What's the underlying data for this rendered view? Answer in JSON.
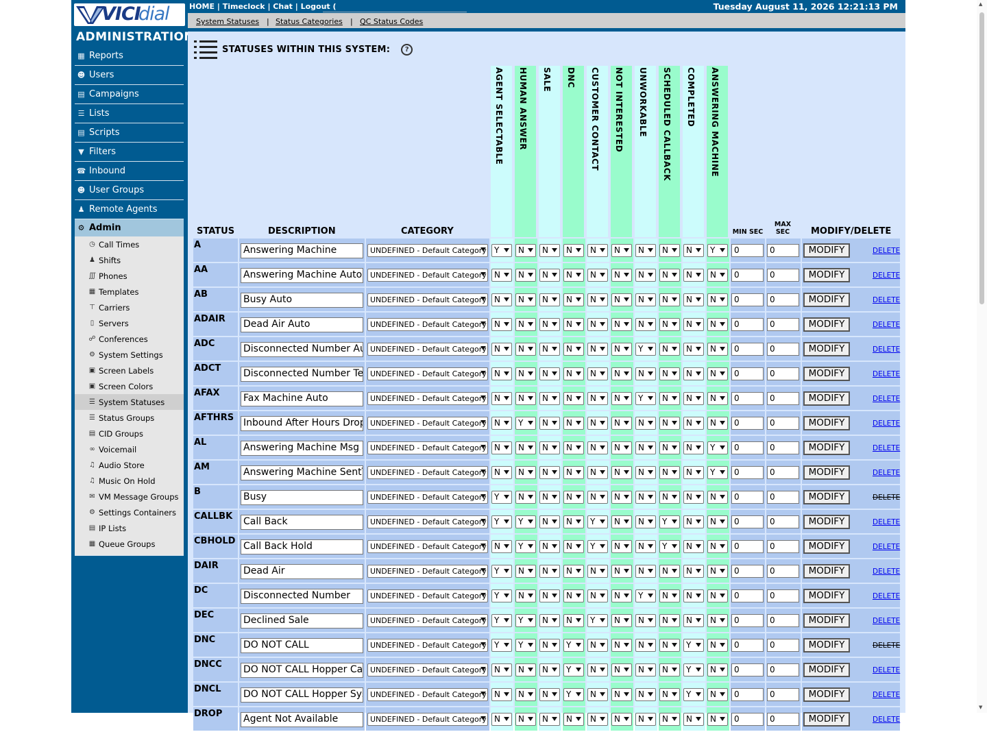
{
  "topbar": {
    "home": "HOME",
    "timeclock": "Timeclock",
    "chat": "Chat",
    "logout": "Logout (",
    "datetime": "Tuesday August 11, 2026 12:21:13 PM"
  },
  "subnav_links": {
    "system_statuses": "System Statuses ",
    "status_categories": "Status Categories ",
    "qc_status_codes": "QC Status Codes"
  },
  "logo": {
    "part1": "VICI",
    "part2": "dial"
  },
  "sidebar": {
    "title": "ADMINISTRATION",
    "items": [
      {
        "label": "Reports",
        "icon": "reports-icon"
      },
      {
        "label": "Users",
        "icon": "users-icon"
      },
      {
        "label": "Campaigns",
        "icon": "campaigns-icon"
      },
      {
        "label": "Lists",
        "icon": "lists-icon"
      },
      {
        "label": "Scripts",
        "icon": "scripts-icon"
      },
      {
        "label": "Filters",
        "icon": "filter-icon"
      },
      {
        "label": "Inbound",
        "icon": "inbound-icon"
      },
      {
        "label": "User Groups",
        "icon": "user-groups-icon"
      },
      {
        "label": "Remote Agents",
        "icon": "remote-agents-icon"
      }
    ],
    "active": {
      "label": "Admin",
      "icon": "gear-icon"
    },
    "subitems": [
      {
        "label": "Call Times",
        "icon": "clock-icon"
      },
      {
        "label": "Shifts",
        "icon": "shifts-icon"
      },
      {
        "label": "Phones",
        "icon": "phones-icon"
      },
      {
        "label": "Templates",
        "icon": "templates-icon"
      },
      {
        "label": "Carriers",
        "icon": "carriers-icon"
      },
      {
        "label": "Servers",
        "icon": "servers-icon"
      },
      {
        "label": "Conferences",
        "icon": "conferences-icon"
      },
      {
        "label": "System Settings",
        "icon": "system-settings-icon"
      },
      {
        "label": "Screen Labels",
        "icon": "screen-labels-icon"
      },
      {
        "label": "Screen Colors",
        "icon": "screen-colors-icon"
      },
      {
        "label": "System Statuses",
        "icon": "system-statuses-icon"
      },
      {
        "label": "Status Groups",
        "icon": "status-groups-icon"
      },
      {
        "label": "CID Groups",
        "icon": "cid-groups-icon"
      },
      {
        "label": "Voicemail",
        "icon": "voicemail-icon"
      },
      {
        "label": "Audio Store",
        "icon": "audio-store-icon"
      },
      {
        "label": "Music On Hold",
        "icon": "music-on-hold-icon"
      },
      {
        "label": "VM Message Groups",
        "icon": "vm-message-groups-icon"
      },
      {
        "label": "Settings Containers",
        "icon": "settings-containers-icon"
      },
      {
        "label": "IP Lists",
        "icon": "ip-lists-icon"
      },
      {
        "label": "Queue Groups",
        "icon": "queue-groups-icon"
      }
    ]
  },
  "page": {
    "title": "STATUSES WITHIN THIS SYSTEM:",
    "help_glyph": "?"
  },
  "columns": {
    "status": "STATUS",
    "description": "DESCRIPTION",
    "category": "CATEGORY",
    "flags": [
      "AGENT SELECTABLE",
      "HUMAN ANSWER",
      "SALE",
      "DNC",
      "CUSTOMER CONTACT",
      "NOT INTERESTED",
      "UNWORKABLE",
      "SCHEDULED CALLBACK",
      "COMPLETED",
      "ANSWERING MACHINE"
    ],
    "min_sec": "MIN SEC",
    "max_sec": "MAX SEC",
    "modify_delete": "MODIFY/DELETE"
  },
  "colors": {
    "flag_cyan": "#ccfcfc",
    "flag_green": "#99fccc",
    "row_bg": "#b0c9f0",
    "page_bg": "#d7e6fc",
    "brand_blue": "#015b91"
  },
  "button_label": "MODIFY",
  "delete_label": "DELETE",
  "category_default": "UNDEFINED - Default Category",
  "rows": [
    {
      "status": "A",
      "desc": "Answering Machine",
      "flags": [
        "Y",
        "N",
        "N",
        "N",
        "N",
        "N",
        "N",
        "N",
        "N",
        "Y"
      ],
      "min": "0",
      "max": "0",
      "delete_disabled": false
    },
    {
      "status": "AA",
      "desc": "Answering Machine Auto",
      "flags": [
        "N",
        "N",
        "N",
        "N",
        "N",
        "N",
        "N",
        "N",
        "N",
        "N"
      ],
      "min": "0",
      "max": "0",
      "delete_disabled": false
    },
    {
      "status": "AB",
      "desc": "Busy Auto",
      "flags": [
        "N",
        "N",
        "N",
        "N",
        "N",
        "N",
        "N",
        "N",
        "N",
        "N"
      ],
      "min": "0",
      "max": "0",
      "delete_disabled": false
    },
    {
      "status": "ADAIR",
      "desc": "Dead Air Auto",
      "flags": [
        "N",
        "N",
        "N",
        "N",
        "N",
        "N",
        "N",
        "N",
        "N",
        "N"
      ],
      "min": "0",
      "max": "0",
      "delete_disabled": false
    },
    {
      "status": "ADC",
      "desc": "Disconnected Number Au",
      "flags": [
        "N",
        "N",
        "N",
        "N",
        "N",
        "N",
        "Y",
        "N",
        "N",
        "N"
      ],
      "min": "0",
      "max": "0",
      "delete_disabled": false
    },
    {
      "status": "ADCT",
      "desc": "Disconnected Number Ter",
      "flags": [
        "N",
        "N",
        "N",
        "N",
        "N",
        "N",
        "N",
        "N",
        "N",
        "N"
      ],
      "min": "0",
      "max": "0",
      "delete_disabled": false
    },
    {
      "status": "AFAX",
      "desc": "Fax Machine Auto",
      "flags": [
        "N",
        "N",
        "N",
        "N",
        "N",
        "N",
        "Y",
        "N",
        "N",
        "N"
      ],
      "min": "0",
      "max": "0",
      "delete_disabled": false
    },
    {
      "status": "AFTHRS",
      "desc": "Inbound After Hours Drop",
      "flags": [
        "N",
        "Y",
        "N",
        "N",
        "N",
        "N",
        "N",
        "N",
        "N",
        "N"
      ],
      "min": "0",
      "max": "0",
      "delete_disabled": false
    },
    {
      "status": "AL",
      "desc": "Answering Machine Msg F",
      "flags": [
        "N",
        "N",
        "N",
        "N",
        "N",
        "N",
        "N",
        "N",
        "N",
        "Y"
      ],
      "min": "0",
      "max": "0",
      "delete_disabled": false
    },
    {
      "status": "AM",
      "desc": "Answering Machine SentT",
      "flags": [
        "N",
        "N",
        "N",
        "N",
        "N",
        "N",
        "N",
        "N",
        "N",
        "Y"
      ],
      "min": "0",
      "max": "0",
      "delete_disabled": false
    },
    {
      "status": "B",
      "desc": "Busy",
      "flags": [
        "Y",
        "N",
        "N",
        "N",
        "N",
        "N",
        "N",
        "N",
        "N",
        "N"
      ],
      "min": "0",
      "max": "0",
      "delete_disabled": true
    },
    {
      "status": "CALLBK",
      "desc": "Call Back",
      "flags": [
        "Y",
        "Y",
        "N",
        "N",
        "Y",
        "N",
        "N",
        "Y",
        "N",
        "N"
      ],
      "min": "0",
      "max": "0",
      "delete_disabled": false
    },
    {
      "status": "CBHOLD",
      "desc": "Call Back Hold",
      "flags": [
        "N",
        "Y",
        "N",
        "N",
        "Y",
        "N",
        "N",
        "Y",
        "N",
        "N"
      ],
      "min": "0",
      "max": "0",
      "delete_disabled": false
    },
    {
      "status": "DAIR",
      "desc": "Dead Air",
      "flags": [
        "Y",
        "N",
        "N",
        "N",
        "N",
        "N",
        "N",
        "N",
        "N",
        "N"
      ],
      "min": "0",
      "max": "0",
      "delete_disabled": false
    },
    {
      "status": "DC",
      "desc": "Disconnected Number",
      "flags": [
        "Y",
        "N",
        "N",
        "N",
        "N",
        "N",
        "Y",
        "N",
        "N",
        "N"
      ],
      "min": "0",
      "max": "0",
      "delete_disabled": false
    },
    {
      "status": "DEC",
      "desc": "Declined Sale",
      "flags": [
        "Y",
        "Y",
        "N",
        "N",
        "Y",
        "N",
        "N",
        "N",
        "N",
        "N"
      ],
      "min": "0",
      "max": "0",
      "delete_disabled": false
    },
    {
      "status": "DNC",
      "desc": "DO NOT CALL",
      "flags": [
        "Y",
        "Y",
        "N",
        "Y",
        "N",
        "N",
        "N",
        "N",
        "Y",
        "N"
      ],
      "min": "0",
      "max": "0",
      "delete_disabled": true
    },
    {
      "status": "DNCC",
      "desc": "DO NOT CALL Hopper Car",
      "flags": [
        "N",
        "N",
        "N",
        "Y",
        "N",
        "N",
        "N",
        "N",
        "Y",
        "N"
      ],
      "min": "0",
      "max": "0",
      "delete_disabled": false
    },
    {
      "status": "DNCL",
      "desc": "DO NOT CALL Hopper Sys",
      "flags": [
        "N",
        "N",
        "N",
        "Y",
        "N",
        "N",
        "N",
        "N",
        "Y",
        "N"
      ],
      "min": "0",
      "max": "0",
      "delete_disabled": false
    },
    {
      "status": "DROP",
      "desc": "Agent Not Available",
      "flags": [
        "N",
        "N",
        "N",
        "N",
        "N",
        "N",
        "N",
        "N",
        "N",
        "N"
      ],
      "min": "0",
      "max": "0",
      "delete_disabled": false
    }
  ]
}
